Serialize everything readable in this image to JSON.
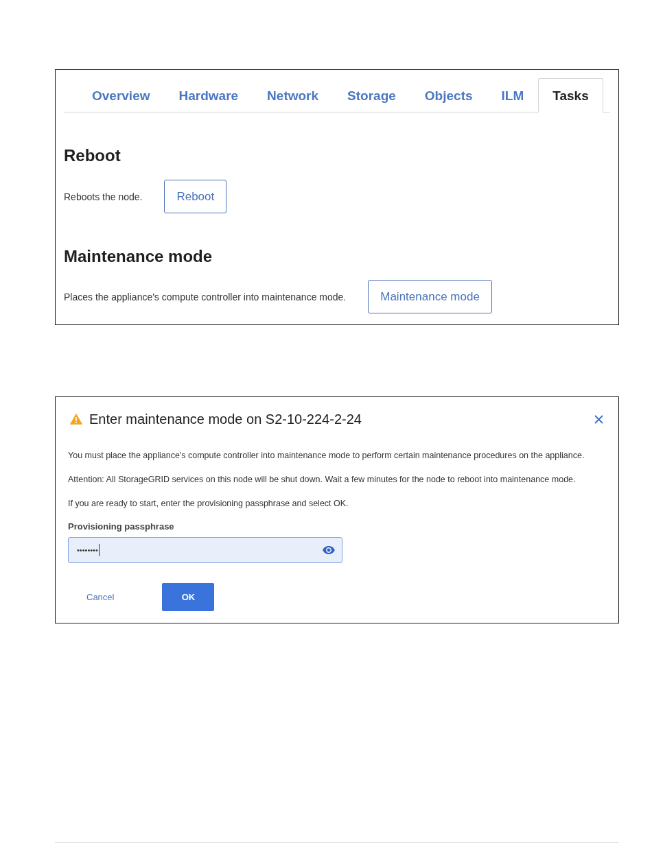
{
  "tabs": [
    {
      "label": "Overview",
      "selected": false
    },
    {
      "label": "Hardware",
      "selected": false
    },
    {
      "label": "Network",
      "selected": false
    },
    {
      "label": "Storage",
      "selected": false
    },
    {
      "label": "Objects",
      "selected": false
    },
    {
      "label": "ILM",
      "selected": false
    },
    {
      "label": "Tasks",
      "selected": true
    }
  ],
  "sections": [
    {
      "heading": "Reboot",
      "description": "Reboots the node.",
      "button": "Reboot"
    },
    {
      "heading": "Maintenance mode",
      "description": "Places the appliance's compute controller into maintenance mode.",
      "button": "Maintenance mode"
    }
  ],
  "dialog": {
    "title": "Enter maintenance mode on S2-10-224-2-24",
    "paragraphs": [
      "You must place the appliance's compute controller into maintenance mode to perform certain maintenance procedures on the appliance.",
      "Attention: All StorageGRID services on this node will be shut down. Wait a few minutes for the node to reboot into maintenance mode.",
      "If you are ready to start, enter the provisioning passphrase and select OK."
    ],
    "field": {
      "label": "Provisioning passphrase",
      "value": "••••••••",
      "focused": true
    },
    "buttons": [
      {
        "label": "Cancel",
        "kind": "link"
      },
      {
        "label": "OK",
        "kind": "primary"
      }
    ]
  }
}
